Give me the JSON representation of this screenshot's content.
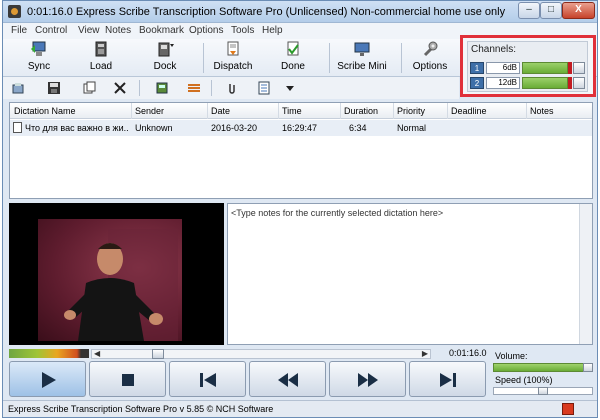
{
  "window": {
    "title": "0:01:16.0 Express Scribe Transcription Software Pro (Unlicensed) Non-commercial home use only",
    "minimize": "–",
    "maximize": "□",
    "close": "X"
  },
  "menu": [
    "File",
    "Control",
    "View",
    "Notes",
    "Bookmark",
    "Options",
    "Tools",
    "Help"
  ],
  "toolbar": {
    "sync": "Sync",
    "load": "Load",
    "dock": "Dock",
    "dispatch": "Dispatch",
    "done": "Done",
    "scribe_mini": "Scribe Mini",
    "options": "Options"
  },
  "channels": {
    "title": "Channels:",
    "ch1": {
      "num": "1",
      "db": "6dB"
    },
    "ch2": {
      "num": "2",
      "db": "12dB"
    }
  },
  "list": {
    "columns": [
      "Dictation Name",
      "Sender",
      "Date",
      "Time",
      "Duration",
      "Priority",
      "Deadline",
      "Notes"
    ],
    "rows": [
      {
        "name": "Что для вас важно в жи...",
        "sender": "Unknown",
        "date": "2016-03-20",
        "time": "16:29:47",
        "duration": "6:34",
        "priority": "Normal",
        "deadline": "",
        "notes": ""
      }
    ]
  },
  "notes": {
    "placeholder": "<Type notes for the currently selected dictation here>"
  },
  "player": {
    "time": "0:01:16.0",
    "volume_label": "Volume:",
    "volume_level": 1.0,
    "speed_label": "Speed (100%)",
    "speed_value": 100
  },
  "status": {
    "text": "Express Scribe Transcription Software Pro v 5.85 © NCH Software"
  },
  "colors": {
    "highlight_border": "#e0303a",
    "meter_green": "#6aac36",
    "peak_red": "#c21c22"
  }
}
